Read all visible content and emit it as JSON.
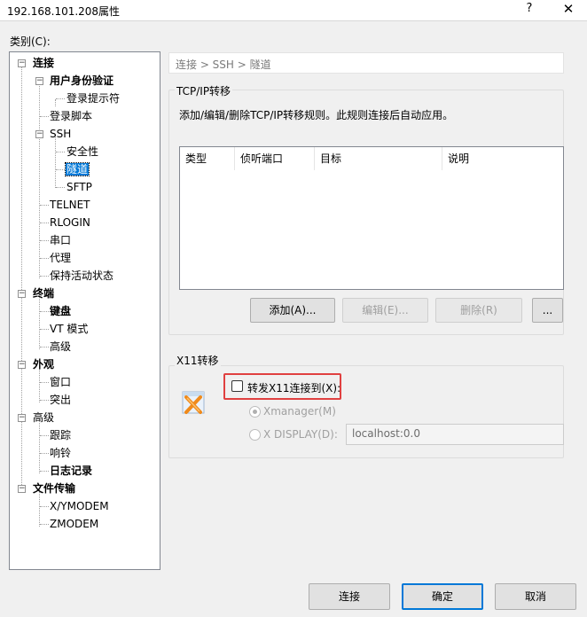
{
  "window": {
    "title": "192.168.101.208属性",
    "help": "?",
    "close": "✕"
  },
  "category_label": "类别(C):",
  "tree": {
    "items": [
      {
        "label": "连接"
      },
      {
        "label": "用户身份验证"
      },
      {
        "label": "登录提示符"
      },
      {
        "label": "登录脚本"
      },
      {
        "label": "SSH"
      },
      {
        "label": "安全性"
      },
      {
        "label": "隧道"
      },
      {
        "label": "SFTP"
      },
      {
        "label": "TELNET"
      },
      {
        "label": "RLOGIN"
      },
      {
        "label": "串口"
      },
      {
        "label": "代理"
      },
      {
        "label": "保持活动状态"
      },
      {
        "label": "终端"
      },
      {
        "label": "键盘"
      },
      {
        "label": "VT 模式"
      },
      {
        "label": "高级"
      },
      {
        "label": "外观"
      },
      {
        "label": "窗口"
      },
      {
        "label": "突出"
      },
      {
        "label": "高级"
      },
      {
        "label": "跟踪"
      },
      {
        "label": "响铃"
      },
      {
        "label": "日志记录"
      },
      {
        "label": "文件传输"
      },
      {
        "label": "X/YMODEM"
      },
      {
        "label": "ZMODEM"
      }
    ],
    "expander_minus": "−"
  },
  "breadcrumb": "连接 > SSH > 隧道",
  "tcpip": {
    "title": "TCP/IP转移",
    "description": "添加/编辑/删除TCP/IP转移规则。此规则连接后自动应用。",
    "columns": [
      "类型",
      "侦听端口",
      "目标",
      "说明"
    ],
    "buttons": {
      "add": "添加(A)...",
      "edit": "编辑(E)...",
      "delete": "删除(R)",
      "more": "..."
    }
  },
  "x11": {
    "title": "X11转移",
    "forward_label": "转发X11连接到(X):",
    "forward_checked": false,
    "option_xmanager": "Xmanager(M)",
    "option_display": "X DISPLAY(D):",
    "display_value": "localhost:0.0"
  },
  "footer": {
    "connect": "连接",
    "ok": "确定",
    "cancel": "取消"
  },
  "colors": {
    "selection": "#0078d7",
    "highlight_box": "#e04040"
  }
}
